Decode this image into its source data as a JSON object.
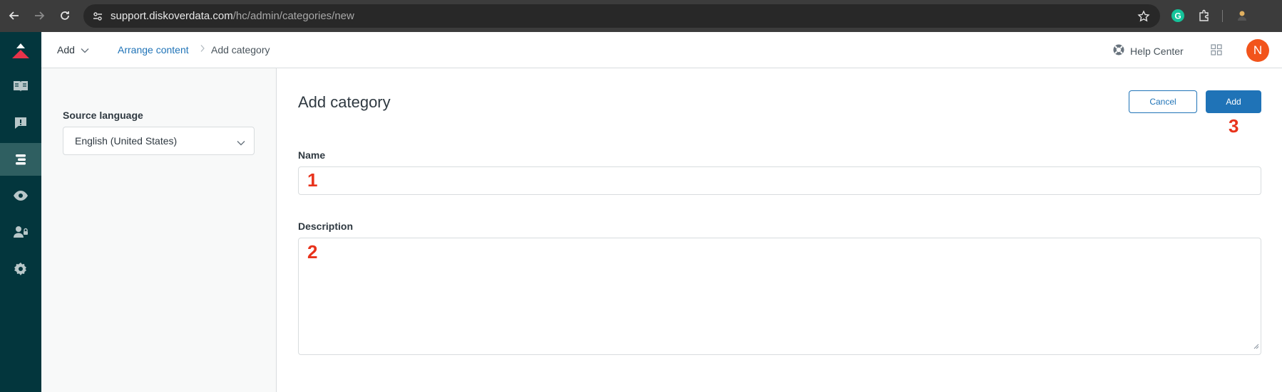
{
  "browser": {
    "url_host": "support.diskoverdata.com",
    "url_path": "/hc/admin/categories/new",
    "icons": [
      "back-icon",
      "forward-icon",
      "reload-icon",
      "site-info-icon",
      "bookmark-star-icon",
      "grammarly-icon",
      "extensions-icon",
      "profile-icon"
    ]
  },
  "rail": {
    "items": [
      {
        "name": "logo",
        "icon": "zendesk-logo-icon"
      },
      {
        "name": "guides",
        "icon": "book-icon"
      },
      {
        "name": "feedback",
        "icon": "feedback-icon"
      },
      {
        "name": "arrange-content",
        "icon": "arrange-icon",
        "active": true
      },
      {
        "name": "preview",
        "icon": "eye-icon"
      },
      {
        "name": "user-permissions",
        "icon": "user-lock-icon"
      },
      {
        "name": "settings",
        "icon": "gear-icon"
      }
    ]
  },
  "topbar": {
    "add_label": "Add",
    "breadcrumb_link": "Arrange content",
    "breadcrumb_current": "Add category",
    "help_center_label": "Help Center",
    "avatar_initial": "N"
  },
  "left_panel": {
    "source_language_label": "Source language",
    "source_language_value": "English (United States)"
  },
  "main": {
    "title": "Add category",
    "cancel_label": "Cancel",
    "add_label": "Add",
    "name_label": "Name",
    "name_value": "",
    "description_label": "Description",
    "description_value": "",
    "annotations": [
      "1",
      "2",
      "3"
    ]
  },
  "colors": {
    "rail_bg": "#03363d",
    "accent": "#1f73b7",
    "avatar": "#f2541b",
    "annotation": "#e8331c"
  }
}
